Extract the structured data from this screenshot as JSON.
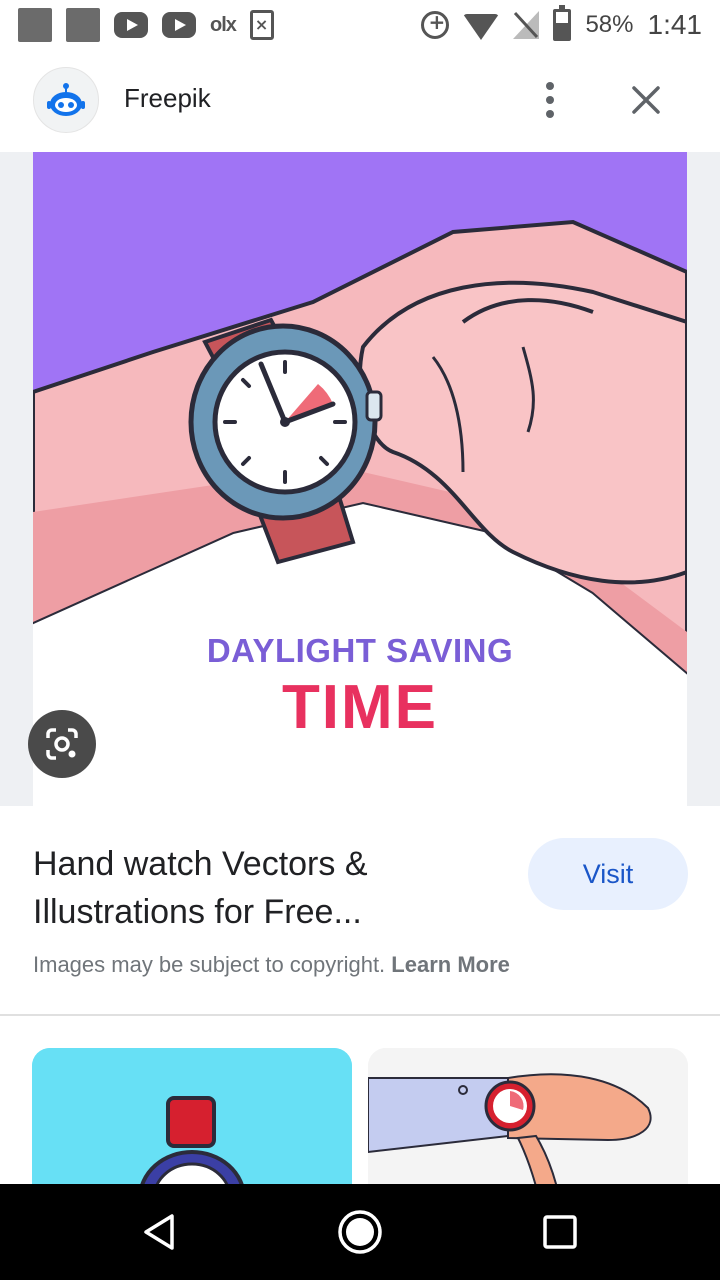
{
  "status_bar": {
    "battery": "58%",
    "time": "1:41",
    "left_icons": [
      "app-icon",
      "app-icon",
      "youtube-icon",
      "youtube-icon",
      "olx-icon",
      "excel-file-icon"
    ],
    "olx_label": "olx"
  },
  "header": {
    "site_name": "Freepik"
  },
  "preview": {
    "image_text_line1": "DAYLIGHT SAVING",
    "image_text_line2": "TIME",
    "background_color": "#a074f5"
  },
  "result": {
    "title": "Hand watch Vectors & Illustrations for Free...",
    "visit_label": "Visit",
    "copyright_text": "Images may be subject to copyright.",
    "learn_more_label": "Learn More"
  },
  "colors": {
    "accent": "#1a56c8",
    "visit_bg": "#e8f0fe",
    "purple_text": "#7a5ed6",
    "red_text": "#e8315f"
  }
}
